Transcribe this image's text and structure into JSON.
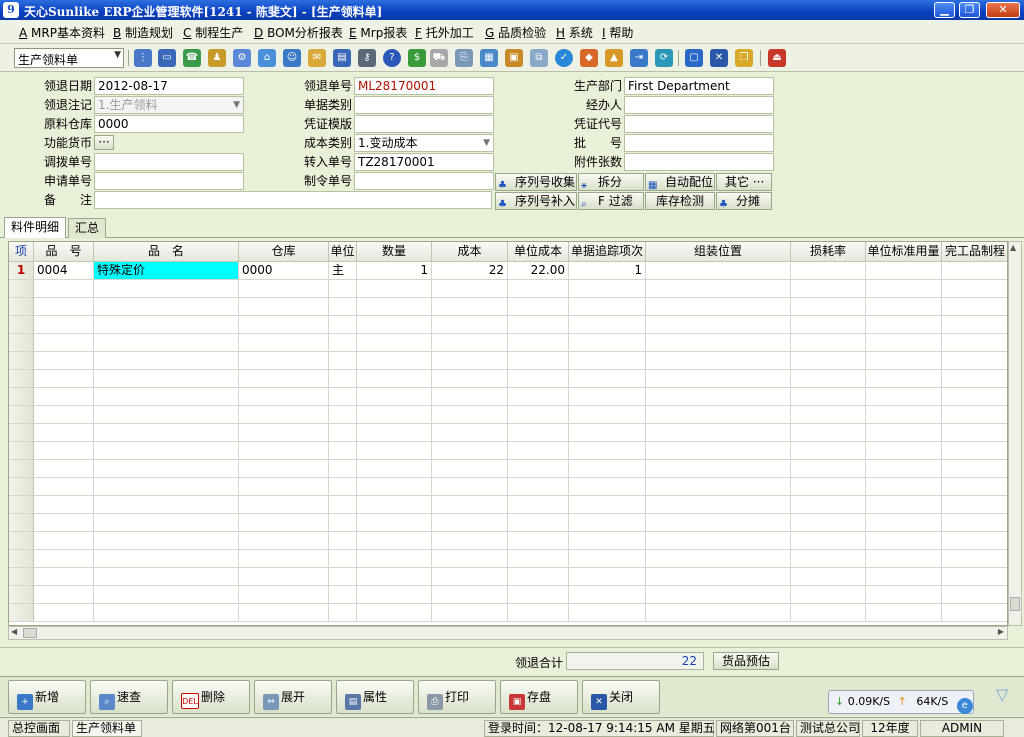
{
  "window": {
    "title": "天心Sunlike ERP企业管理软件[1241 - 陈斐文] - [生产领料单]",
    "app_icon": "9"
  },
  "menu": [
    {
      "key": "A",
      "label": " MRP基本资料"
    },
    {
      "key": "B",
      "label": " 制造规划"
    },
    {
      "key": "C",
      "label": " 制程生产"
    },
    {
      "key": "D",
      "label": " BOM分析报表"
    },
    {
      "key": "E",
      "label": " Mrp报表"
    },
    {
      "key": "F",
      "label": " 托外加工"
    },
    {
      "key": "G",
      "label": " 品质检验"
    },
    {
      "key": "H",
      "label": " 系统"
    },
    {
      "key": "I",
      "label": " 帮助"
    }
  ],
  "toolbar": {
    "form_select": "生产领料单"
  },
  "form": {
    "ly_date": {
      "label": "领退日期",
      "value": "2012-08-17"
    },
    "ly_flag": {
      "label": "领退注记",
      "value": "1.生产领料"
    },
    "warehouse": {
      "label": "原料仓库",
      "value": "0000"
    },
    "currency": {
      "label": "功能货币",
      "value": "···"
    },
    "transfer_no": {
      "label": "调拨单号",
      "value": ""
    },
    "apply_no": {
      "label": "申请单号",
      "value": ""
    },
    "remark": {
      "label": "备　　注",
      "value": ""
    },
    "ly_no": {
      "label": "领退单号",
      "value": "ML28170001"
    },
    "doc_type": {
      "label": "单据类别",
      "value": ""
    },
    "voucher_tpl": {
      "label": "凭证模版",
      "value": ""
    },
    "cost_type": {
      "label": "成本类别",
      "value": "1.变动成本"
    },
    "in_no": {
      "label": "转入单号",
      "value": "TZ28170001"
    },
    "mo_no": {
      "label": "制令单号",
      "value": ""
    },
    "dept": {
      "label": "生产部门",
      "value": "First Department"
    },
    "handler": {
      "label": "经办人",
      "value": ""
    },
    "voucher_code": {
      "label": "凭证代号",
      "value": ""
    },
    "batch": {
      "label": "批　　号",
      "value": ""
    },
    "attach": {
      "label": "附件张数",
      "value": ""
    }
  },
  "actions": {
    "serial_collect": "序列号收集",
    "split": "拆分",
    "auto_alloc": "自动配位",
    "other": "其它 ···",
    "serial_fill": "序列号补入",
    "filter": "F 过滤",
    "stock_check": "库存检测",
    "allocate": "分摊"
  },
  "tabs": [
    "料件明细",
    "汇总"
  ],
  "grid": {
    "headers": [
      "项",
      "品　号",
      "品　名",
      "仓库",
      "单位",
      "数量",
      "成本",
      "单位成本",
      "单据追踪项次",
      "组装位置",
      "损耗率",
      "单位标准用量",
      "完工品制程"
    ],
    "rows": [
      [
        "1",
        "0004",
        "特殊定价",
        "0000",
        "主",
        "1",
        "22",
        "22.00",
        "1",
        "",
        "",
        "",
        ""
      ]
    ]
  },
  "totals": {
    "label": "领退合计",
    "value": "22",
    "button": "货品预估"
  },
  "bottom_buttons": [
    {
      "label": "新增",
      "icon": "plus-icon"
    },
    {
      "label": "速查",
      "icon": "magnifier-icon"
    },
    {
      "label": "删除",
      "icon": "del-icon"
    },
    {
      "label": "展开",
      "icon": "expand-icon"
    },
    {
      "label": "属性",
      "icon": "properties-icon"
    },
    {
      "label": "打印",
      "icon": "printer-icon"
    },
    {
      "label": "存盘",
      "icon": "floppy-icon"
    },
    {
      "label": "关闭",
      "icon": "close-icon"
    }
  ],
  "netspeed": {
    "down": "0.09K/S",
    "up": "64K/S"
  },
  "status": {
    "home": "总控画面",
    "form": "生产领料单",
    "login": "登录时间：12-08-17 9:14:15 AM  星期五",
    "station": "网络第001台",
    "company": "测试总公司",
    "year": "12年度",
    "user": "ADMIN"
  },
  "colors": {
    "accent": "#0a3fbf",
    "highlight_cell": "#00ffff",
    "row_marker": "#c00000",
    "value_blue": "#1a3fb0"
  }
}
